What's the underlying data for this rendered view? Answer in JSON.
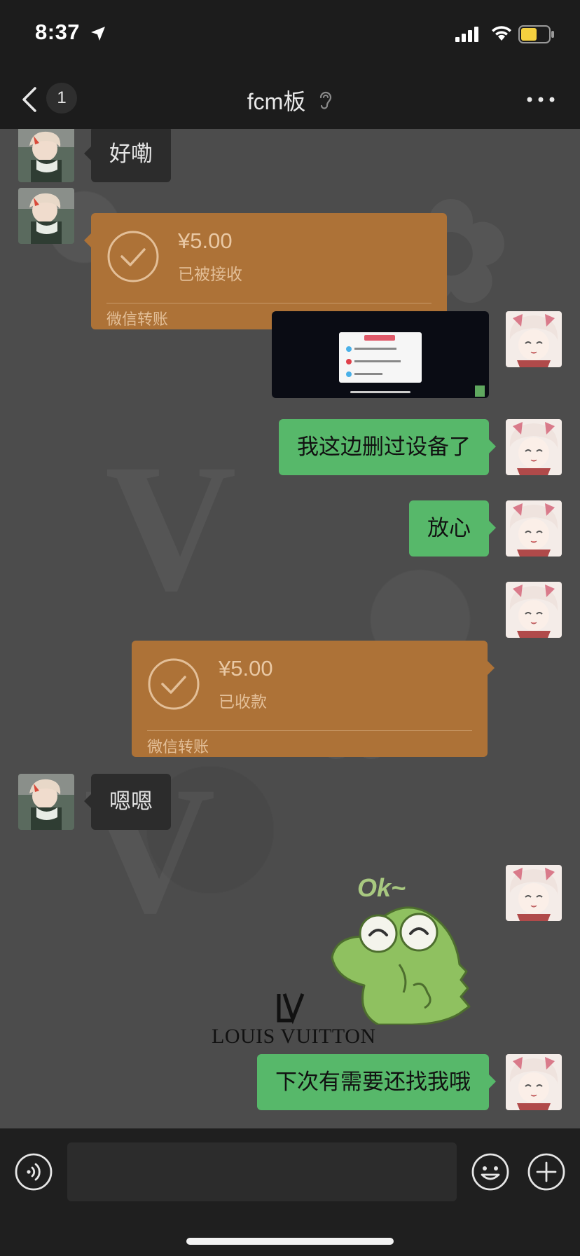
{
  "status_bar": {
    "time": "8:37"
  },
  "nav": {
    "unread_count": "1",
    "title": "fcm板"
  },
  "messages": [
    {
      "side": "in",
      "type": "text",
      "text": "好嘞"
    },
    {
      "side": "in",
      "type": "transfer",
      "amount": "¥5.00",
      "status": "已被接收",
      "label": "微信转账"
    },
    {
      "side": "out",
      "type": "image"
    },
    {
      "side": "out",
      "type": "text",
      "text": "我这边删过设备了"
    },
    {
      "side": "out",
      "type": "text",
      "text": "放心"
    },
    {
      "side": "out",
      "type": "transfer",
      "amount": "¥5.00",
      "status": "已收款",
      "label": "微信转账"
    },
    {
      "side": "in",
      "type": "text",
      "text": "嗯嗯"
    },
    {
      "side": "out",
      "type": "sticker",
      "caption": "Ok~"
    },
    {
      "side": "out",
      "type": "text",
      "text": "下次有需要还找我哦"
    }
  ],
  "wallpaper": {
    "brand": "LOUIS VUITTON"
  },
  "colors": {
    "bubble_out": "#57b86a",
    "bubble_in": "#2c2c2c",
    "transfer": "#ad7237"
  }
}
